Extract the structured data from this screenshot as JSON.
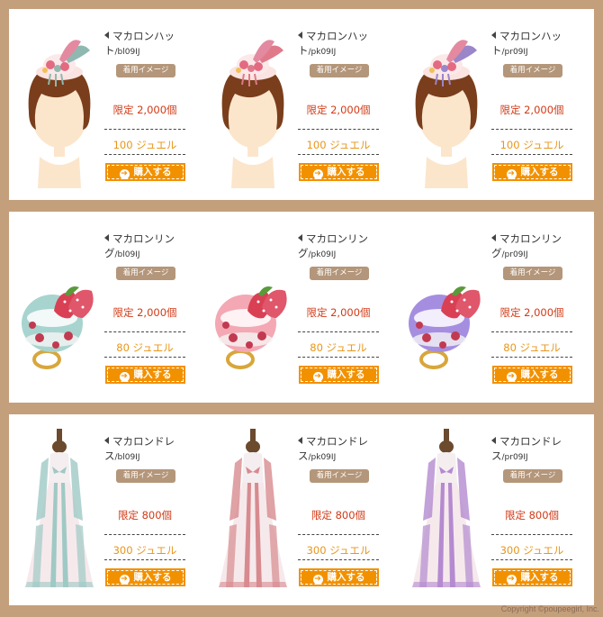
{
  "rows": [
    {
      "kind": "hat",
      "items": [
        {
          "name": "マカロンハット",
          "code": "/bl09IJ",
          "wear_label": "着用イメージ",
          "limit": "限定 2,000個",
          "price": "100 ジュエル",
          "buy_label": "購入する",
          "accent": "#8fb8b0"
        },
        {
          "name": "マカロンハット",
          "code": "/pk09IJ",
          "wear_label": "着用イメージ",
          "limit": "限定 2,000個",
          "price": "100 ジュエル",
          "buy_label": "購入する",
          "accent": "#e07a8a"
        },
        {
          "name": "マカロンハット",
          "code": "/pr09IJ",
          "wear_label": "着用イメージ",
          "limit": "限定 2,000個",
          "price": "100 ジュエル",
          "buy_label": "購入する",
          "accent": "#9a86c8"
        }
      ]
    },
    {
      "kind": "ring",
      "items": [
        {
          "name": "マカロンリング",
          "code": "/bl09IJ",
          "wear_label": "着用イメージ",
          "limit": "限定 2,000個",
          "price": "80 ジュエル",
          "buy_label": "購入する",
          "accent": "#a8d4cf"
        },
        {
          "name": "マカロンリング",
          "code": "/pk09IJ",
          "wear_label": "着用イメージ",
          "limit": "限定 2,000個",
          "price": "80 ジュエル",
          "buy_label": "購入する",
          "accent": "#f3a8b4"
        },
        {
          "name": "マカロンリング",
          "code": "/pr09IJ",
          "wear_label": "着用イメージ",
          "limit": "限定 2,000個",
          "price": "80 ジュエル",
          "buy_label": "購入する",
          "accent": "#a58ee0"
        }
      ]
    },
    {
      "kind": "dress",
      "items": [
        {
          "name": "マカロンドレス",
          "code": "/bl09IJ",
          "wear_label": "着用イメージ",
          "limit": "限定 800個",
          "price": "300 ジュエル",
          "buy_label": "購入する",
          "accent": "#9fc9c4"
        },
        {
          "name": "マカロンドレス",
          "code": "/pk09IJ",
          "wear_label": "着用イメージ",
          "limit": "限定 800個",
          "price": "300 ジュエル",
          "buy_label": "購入する",
          "accent": "#d78b8f"
        },
        {
          "name": "マカロンドレス",
          "code": "/pr09IJ",
          "wear_label": "着用イメージ",
          "limit": "限定 800個",
          "price": "300 ジュエル",
          "buy_label": "購入する",
          "accent": "#b48ad0"
        }
      ]
    }
  ],
  "colors": {
    "background": "#c49f7c",
    "limit_text": "#d23a16",
    "price_text": "#e8961a",
    "buy_button": "#f29100",
    "wear_badge": "#b4967a"
  },
  "copyright": "Copyright ©poupeegirl, Inc."
}
